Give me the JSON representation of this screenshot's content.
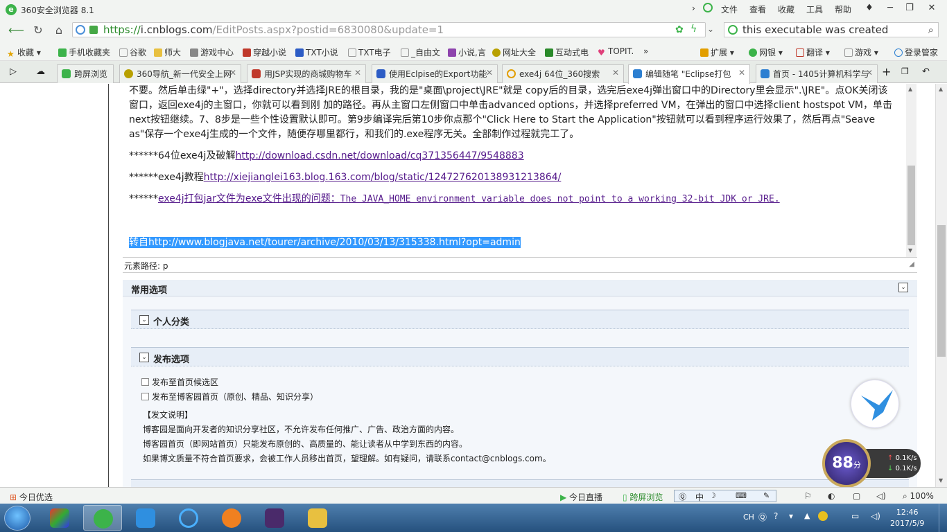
{
  "browser": {
    "title": "360安全浏览器 8.1",
    "menu": [
      "文件",
      "查看",
      "收藏",
      "工具",
      "帮助"
    ],
    "url_prefix": "https://",
    "url_host": "i.cnblogs.com",
    "url_path": "/EditPosts.aspx?postid=6830080&update=1",
    "search_text": "this executable was created"
  },
  "bookmarks": {
    "left": [
      "收藏",
      "手机收藏夹",
      "谷歌",
      "师大",
      "游戏中心",
      "穿越小说",
      "TXT小说",
      "TXT电子",
      "_自由文",
      "小说,言",
      "网址大全",
      "互动式电",
      "TOPIT."
    ],
    "right": [
      "扩展",
      "网银",
      "翻译",
      "游戏",
      "登录管家"
    ]
  },
  "tabs": [
    {
      "label": "跨屏浏览"
    },
    {
      "label": "360导航_新一代安全上网"
    },
    {
      "label": "用JSP实现的商城购物车"
    },
    {
      "label": "使用Eclpise的Export功能"
    },
    {
      "label": "exe4j 64位_360搜索"
    },
    {
      "label": "编辑随笔 \"Eclipse打包"
    },
    {
      "label": "首页 - 1405计算机科学与"
    }
  ],
  "editor": {
    "para1_line1": "不要。然后单击绿\"+\"，选择directory并选择JRE的根目录，我的是\"桌面\\project\\JRE\"就是 copy后的目录，选完后exe4j弹出窗口中的Directory里会显示\".\\JRE\"。点OK关闭该",
    "para1_line2": "窗口，返回exe4j的主窗口，你就可以看到刚 加的路径。再从主窗口左侧窗口中单击advanced options，并选择preferred VM，在弹出的窗口中选择client hostspot VM，单击",
    "para1_line3": "next按钮继续。7、8步是一些个性设置默认即可。第9步编译完后第10步你点那个\"Click Here to Start the Application\"按钮就可以看到程序运行效果了，然后再点\"Seave",
    "para1_line4": "as\"保存一个exe4j生成的一个文件，随便存哪里都行，和我们的.exe程序无关。全部制作过程就完工了。",
    "l1_prefix": "******64位exe4j及破解",
    "l1_link": "http://download.csdn.net/download/cq371356447/9548883",
    "l2_prefix": "******exe4j教程",
    "l2_link": "http://xiejianglei163.blog.163.com/blog/static/1247276201389312138​64/",
    "l3_prefix": "******",
    "l3_link_cn": "exe4j打包jar文件为exe文件出现的问题：",
    "l3_link_en": "The JAVA_HOME environment variable does not point to a working 32-bit JDK or JRE.",
    "sel_prefix": "转自",
    "sel_link": "http://www.blogjava.net/tourer/archive/2010/03/13/315338.html?opt=admin"
  },
  "pathbar": "元素路径: p",
  "options": {
    "header": "常用选项",
    "section1": "个人分类",
    "section2": "发布选项",
    "check1": "发布至首页候选区",
    "check2": "发布至博客园首页（原创、精品、知识分享）",
    "note_title": "【发文说明】",
    "note1": "博客园是面向开发者的知识分享社区，不允许发布任何推广、广告、政治方面的内容。",
    "note2": "博客园首页（即网站首页）只能发布原创的、高质量的、能让读者从中学到东西的内容。",
    "note3": "如果博文质量不符合首页要求，会被工作人员移出首页，望理解。如有疑问，请联系contact@cnblogs.com。"
  },
  "widgets": {
    "score": "88",
    "score_unit": "分",
    "up_speed": "0.1K/s",
    "down_speed": "0.1K/s"
  },
  "statusbar": {
    "left": "今日优选",
    "live": "今日直播",
    "cross": "跨屏浏览",
    "ime": "中",
    "zoom": "100%"
  },
  "taskbar": {
    "lang": "CH",
    "time": "12:46",
    "date": "2017/5/9"
  },
  "colors": {
    "accent": "#3cb34a",
    "link": "#551a8b",
    "selection": "#3399ff"
  }
}
